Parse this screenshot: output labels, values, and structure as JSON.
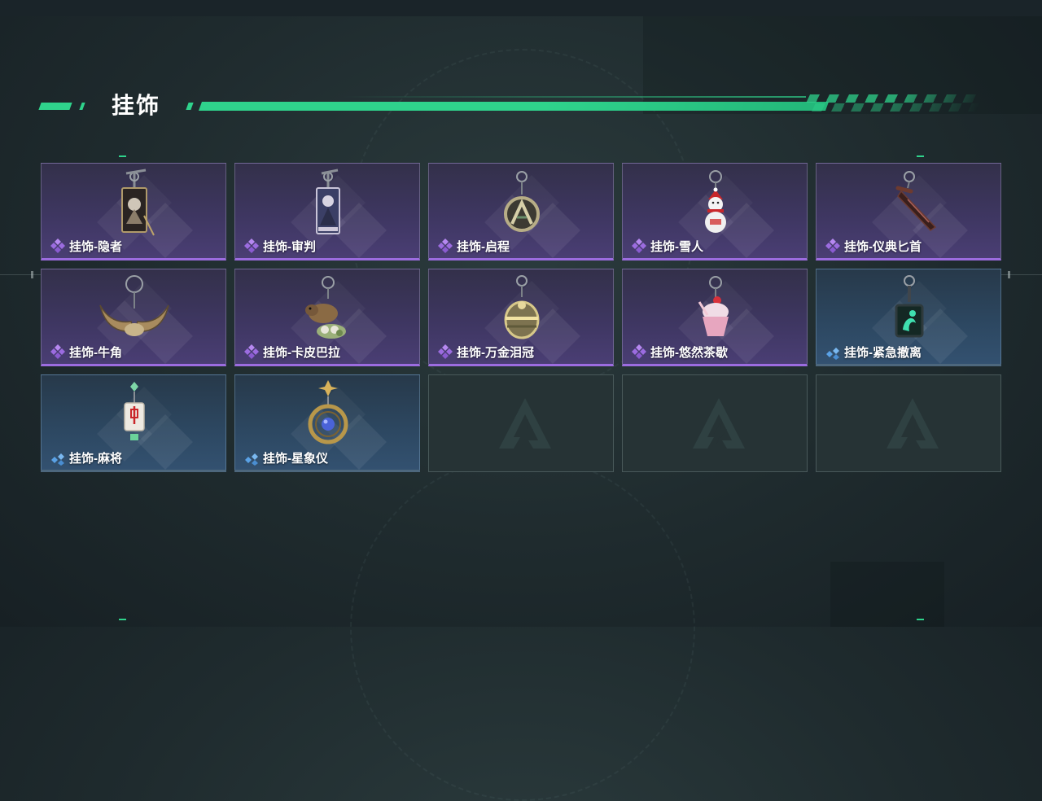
{
  "section": {
    "title": "挂饰"
  },
  "colors": {
    "accent": "#2fd38c",
    "rarity_purple": "#9c6ce0",
    "rarity_blue": "#5aa2e6"
  },
  "items": [
    {
      "label": "挂饰-隐者",
      "rarity": "purple",
      "icon": "tarot-card-hermit-icon"
    },
    {
      "label": "挂饰-审判",
      "rarity": "purple",
      "icon": "tarot-card-judgement-icon"
    },
    {
      "label": "挂饰-启程",
      "rarity": "purple",
      "icon": "medallion-icon"
    },
    {
      "label": "挂饰-雪人",
      "rarity": "purple",
      "icon": "snowman-icon"
    },
    {
      "label": "挂饰-仪典匕首",
      "rarity": "purple",
      "icon": "dagger-icon"
    },
    {
      "label": "挂饰-牛角",
      "rarity": "purple",
      "icon": "bull-horns-icon"
    },
    {
      "label": "挂饰-卡皮巴拉",
      "rarity": "purple",
      "icon": "capybara-icon"
    },
    {
      "label": "挂饰-万金泪冠",
      "rarity": "purple",
      "icon": "crown-orb-icon"
    },
    {
      "label": "挂饰-悠然茶歇",
      "rarity": "purple",
      "icon": "cupcake-icon"
    },
    {
      "label": "挂饰-紧急撤离",
      "rarity": "blue",
      "icon": "emergency-tag-icon"
    },
    {
      "label": "挂饰-麻将",
      "rarity": "blue",
      "icon": "mahjong-tile-icon"
    },
    {
      "label": "挂饰-星象仪",
      "rarity": "blue",
      "icon": "astrolabe-icon"
    }
  ],
  "empty_slots": 3
}
